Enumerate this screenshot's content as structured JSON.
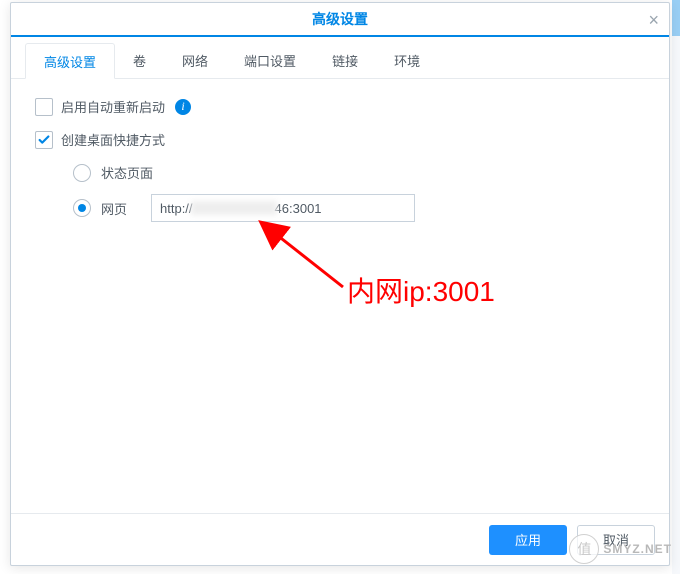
{
  "dialog": {
    "title": "高级设置",
    "close_glyph": "×"
  },
  "tabs": [
    {
      "label": "高级设置",
      "active": true
    },
    {
      "label": "卷",
      "active": false
    },
    {
      "label": "网络",
      "active": false
    },
    {
      "label": "端口设置",
      "active": false
    },
    {
      "label": "链接",
      "active": false
    },
    {
      "label": "环境",
      "active": false
    }
  ],
  "options": {
    "auto_restart": {
      "label": "启用自动重新启动",
      "checked": false,
      "info_glyph": "i"
    },
    "create_shortcut": {
      "label": "创建桌面快捷方式",
      "checked": true
    },
    "radios": {
      "status_page": {
        "label": "状态页面",
        "selected": false
      },
      "web_page": {
        "label": "网页",
        "selected": true
      }
    },
    "url_input": {
      "prefix": "http://",
      "masked_middle": true,
      "suffix": "46:3001"
    }
  },
  "annotation": {
    "text": "内网ip:3001",
    "color": "#ff0000"
  },
  "footer": {
    "apply": "应用",
    "cancel": "取消"
  },
  "watermark": {
    "circle": "值",
    "text": "SMYZ.NET"
  }
}
